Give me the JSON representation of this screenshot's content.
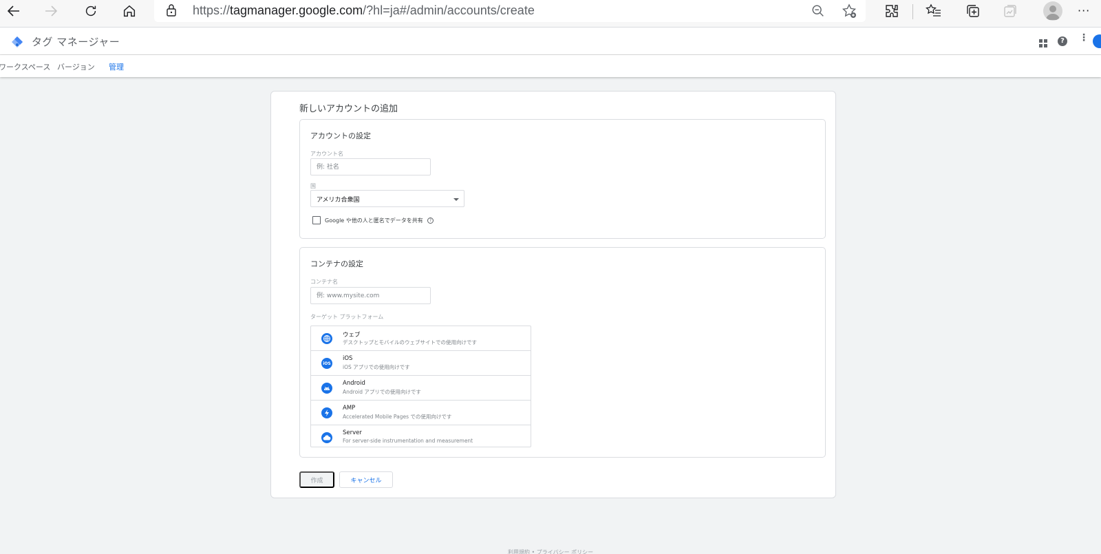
{
  "browser": {
    "url_prefix": "https://",
    "url_host": "tagmanager.google.com",
    "url_path": "/?hl=ja#/admin/accounts/create"
  },
  "app": {
    "title": "タグ マネージャー",
    "tabs": [
      {
        "label": "ワークスペース"
      },
      {
        "label": "バージョン"
      },
      {
        "label": "管理"
      }
    ]
  },
  "form": {
    "title": "新しいアカウントの追加",
    "account_section": {
      "title": "アカウントの設定",
      "account_name_label": "アカウント名",
      "account_name_placeholder": "例: 社名",
      "account_name_value": "",
      "country_label": "国",
      "country_value": "アメリカ合衆国",
      "share_label": "Google や他の人と匿名でデータを共有"
    },
    "container_section": {
      "title": "コンテナの設定",
      "container_name_label": "コンテナ名",
      "container_name_placeholder": "例: www.mysite.com",
      "container_name_value": "",
      "platform_label": "ターゲット プラットフォーム",
      "platforms": [
        {
          "name": "ウェブ",
          "description": "デスクトップとモバイルのウェブサイトでの使用向けです",
          "icon": "web-icon"
        },
        {
          "name": "iOS",
          "description": "iOS アプリでの使用向けです",
          "icon": "ios-icon"
        },
        {
          "name": "Android",
          "description": "Android アプリでの使用向けです",
          "icon": "android-icon"
        },
        {
          "name": "AMP",
          "description": "Accelerated Mobile Pages での使用向けです",
          "icon": "amp-icon"
        },
        {
          "name": "Server",
          "description": "For server-side instrumentation and measurement",
          "icon": "server-icon"
        }
      ]
    },
    "create_label": "作成",
    "cancel_label": "キャンセル"
  },
  "footer": {
    "text": "利用規約 • プライバシー ポリシー"
  },
  "colors": {
    "accent": "#1a73e8",
    "background": "#f1f3f4"
  }
}
